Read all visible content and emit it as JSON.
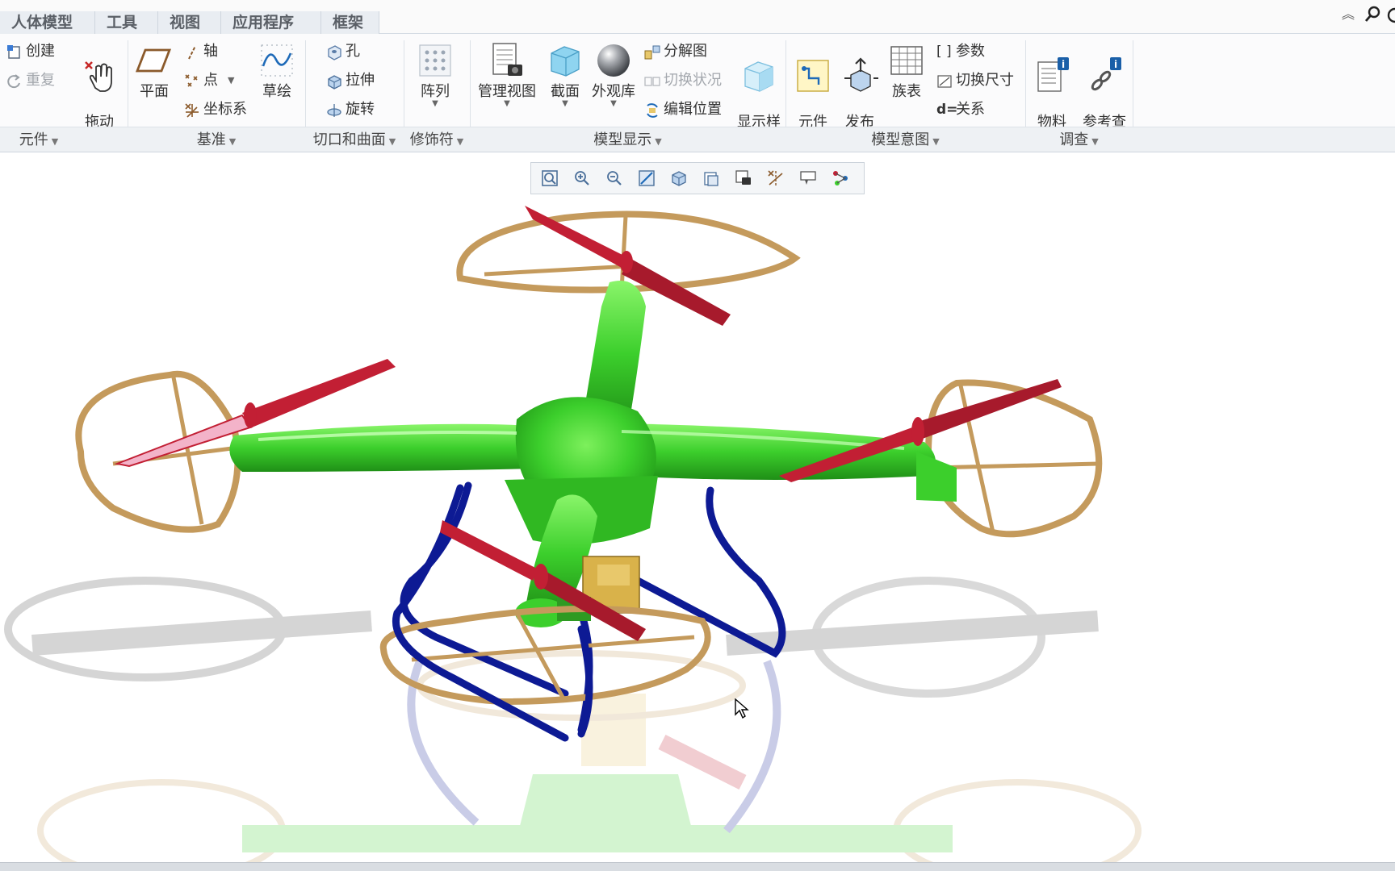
{
  "menu": {
    "tabs": [
      "人体模型",
      "工具",
      "视图",
      "应用程序",
      "框架"
    ]
  },
  "ribbon": {
    "create": "创建",
    "redo": "重复",
    "drag": "拖动\n元件",
    "plane": "平面",
    "axis": "轴",
    "point": "点",
    "csys": "坐标系",
    "sketch": "草绘",
    "hole": "孔",
    "extrude": "拉伸",
    "revolve": "旋转",
    "pattern": "阵列",
    "manage_views": "管理视图",
    "section": "截面",
    "appearance": "外观库",
    "exploded": "分解图",
    "toggle_status": "切换状况",
    "edit_position": "编辑位置",
    "display_style": "显示样\n式",
    "comp_interface": "元件\n界面",
    "publish_geom": "发布\n几何",
    "family_table": "族表",
    "parameters": "参数",
    "switch_dims": "切换尺寸",
    "relations": "关系",
    "bom": "物料\n清单",
    "ref_viewer": "参考查\n看器"
  },
  "groups": [
    "元件",
    "基准",
    "切口和曲面",
    "修饰符",
    "模型显示",
    "模型意图",
    "调查"
  ],
  "colors": {
    "body": "#3ccf2c",
    "propeller": "#c21f34",
    "guard": "#c49a5c",
    "landing_gear": "#0d1a94",
    "ribbon_bg": "#fbfbfc"
  }
}
